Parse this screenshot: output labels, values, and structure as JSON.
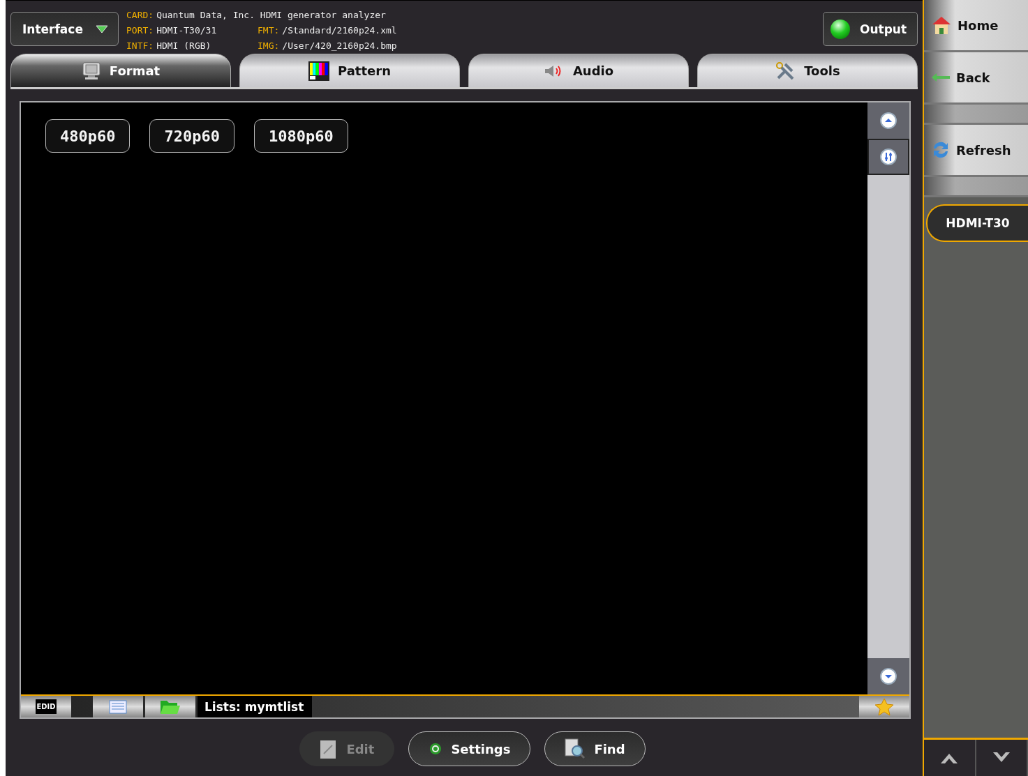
{
  "interface_button": {
    "label": "Interface"
  },
  "info": [
    [
      {
        "key": "CARD:",
        "value": "Quantum Data, Inc. HDMI generator analyzer"
      }
    ],
    [
      {
        "key": "PORT:",
        "value": "HDMI-T30/31"
      },
      {
        "key": "FMT:",
        "value": "/Standard/2160p24.xml"
      }
    ],
    [
      {
        "key": "INTF:",
        "value": "HDMI (RGB)"
      },
      {
        "key": "IMG:",
        "value": "/User/420_2160p24.bmp"
      }
    ]
  ],
  "output_button": {
    "label": "Output",
    "on": true
  },
  "tabs": [
    {
      "label": "Format",
      "kind": "format",
      "selected": true
    },
    {
      "label": "Pattern",
      "kind": "pattern",
      "selected": false
    },
    {
      "label": "Audio",
      "kind": "audio",
      "selected": false
    },
    {
      "label": "Tools",
      "kind": "tools",
      "selected": false
    }
  ],
  "format_buttons": [
    "480p60",
    "720p60",
    "1080p60"
  ],
  "list_bar": {
    "edid": "EDID",
    "label": "Lists: mymtlist"
  },
  "bottom_buttons": [
    {
      "label": "Edit",
      "kind": "edit",
      "disabled": true
    },
    {
      "label": "Settings",
      "kind": "settings",
      "disabled": false
    },
    {
      "label": "Find",
      "kind": "find",
      "disabled": false
    }
  ],
  "sidebar": {
    "items": [
      {
        "label": "Home",
        "kind": "home"
      },
      {
        "label": "Back",
        "kind": "back"
      },
      {
        "label": "Refresh",
        "kind": "refresh"
      }
    ],
    "device": "HDMI-T30"
  }
}
